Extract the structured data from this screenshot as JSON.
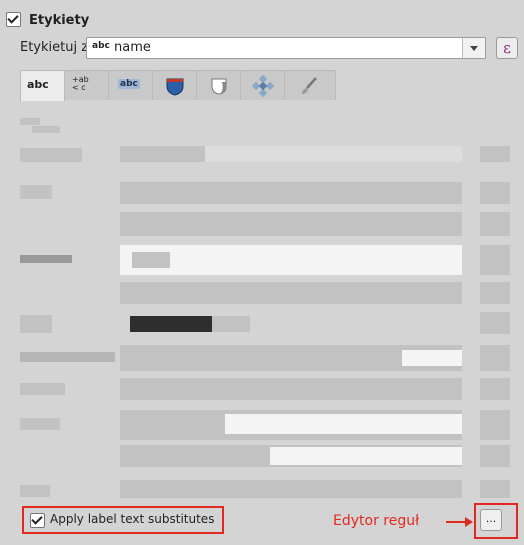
{
  "section": {
    "title": "Etykiety",
    "checked": true
  },
  "label_from": {
    "label": "Etykietuj z",
    "type_badge": "abc",
    "value": "name",
    "expression_icon": "ε"
  },
  "tabs": [
    {
      "name": "text",
      "label": "abc",
      "icon": "text-abc-icon"
    },
    {
      "name": "formatting",
      "label": "+ab <c",
      "icon": "formatting-icon"
    },
    {
      "name": "buffer",
      "label": "abc",
      "icon": "buffer-icon"
    },
    {
      "name": "background",
      "label": "",
      "icon": "shield-icon"
    },
    {
      "name": "shadow",
      "label": "",
      "icon": "shadow-icon"
    },
    {
      "name": "placement",
      "label": "",
      "icon": "placement-icon"
    },
    {
      "name": "rendering",
      "label": "",
      "icon": "brush-icon"
    }
  ],
  "substitutes": {
    "label": "Apply label text substitutes",
    "checked": true
  },
  "annotation": {
    "label": "Edytor reguł"
  },
  "ellipsis_button": {
    "label": "..."
  },
  "colors": {
    "accent_red": "#e02a1f",
    "purple": "#8b2a7b"
  }
}
